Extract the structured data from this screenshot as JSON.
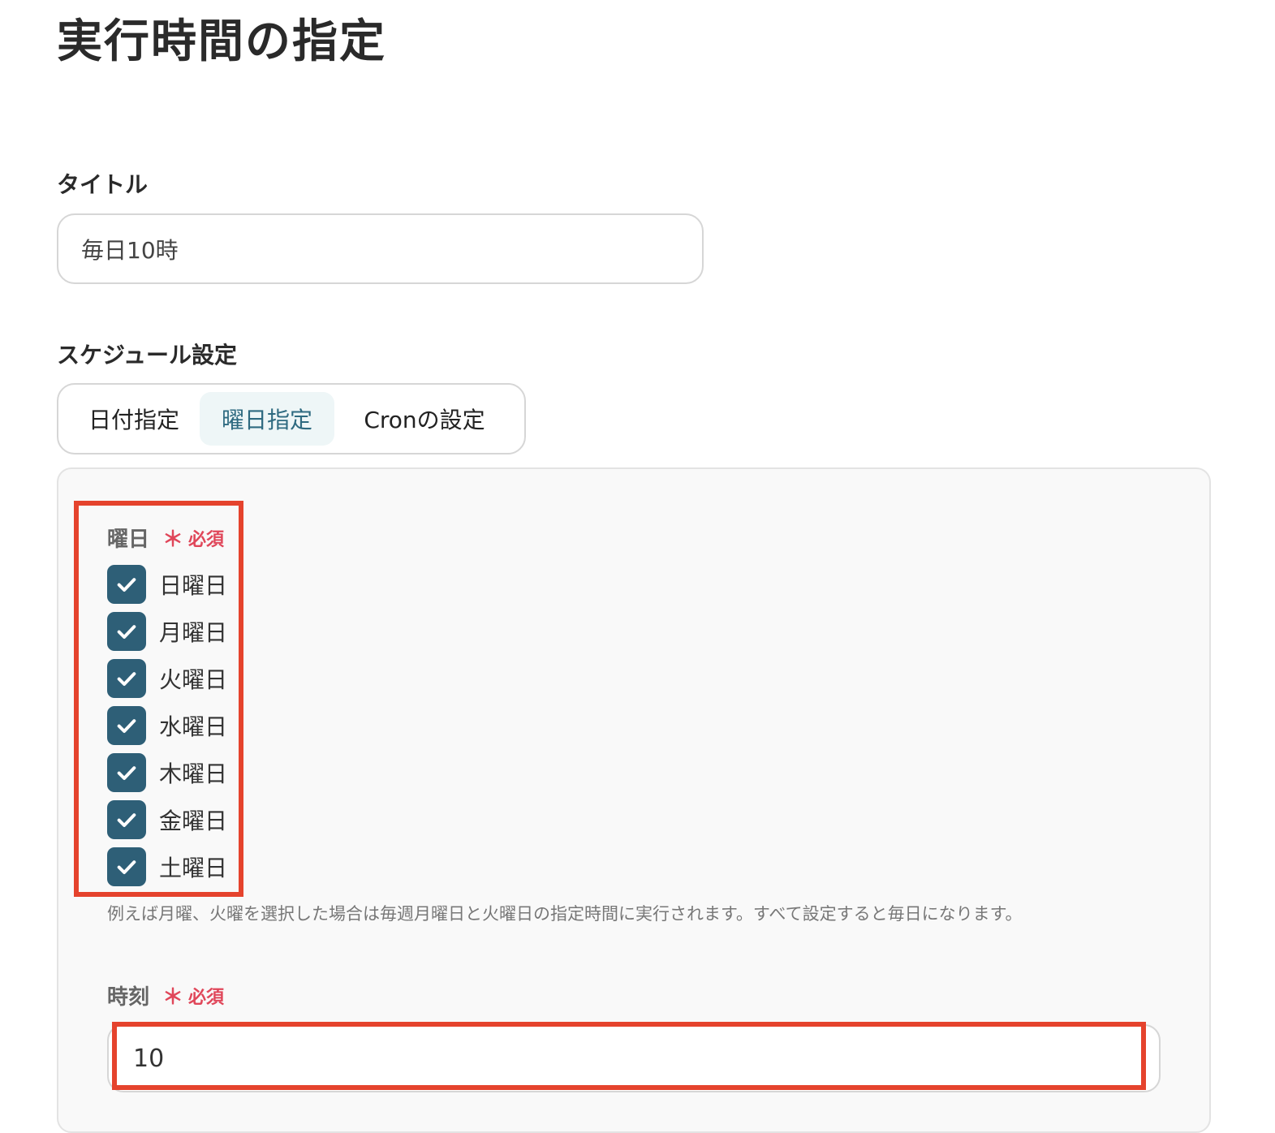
{
  "page": {
    "title": "実行時間の指定"
  },
  "title_field": {
    "label": "タイトル",
    "value": "毎日10時"
  },
  "schedule": {
    "label": "スケジュール設定",
    "tabs": [
      {
        "label": "日付指定",
        "selected": false
      },
      {
        "label": "曜日指定",
        "selected": true
      },
      {
        "label": "Cronの設定",
        "selected": false
      }
    ]
  },
  "weekday": {
    "label": "曜日",
    "required_mark": "＊",
    "required_text": "必須",
    "days": [
      {
        "label": "日曜日",
        "checked": true
      },
      {
        "label": "月曜日",
        "checked": true
      },
      {
        "label": "火曜日",
        "checked": true
      },
      {
        "label": "水曜日",
        "checked": true
      },
      {
        "label": "木曜日",
        "checked": true
      },
      {
        "label": "金曜日",
        "checked": true
      },
      {
        "label": "土曜日",
        "checked": true
      }
    ],
    "hint": "例えば月曜、火曜を選択した場合は毎週月曜日と火曜日の指定時間に実行されます。すべて設定すると毎日になります。"
  },
  "time": {
    "label": "時刻",
    "required_mark": "＊",
    "required_text": "必須",
    "value": "10"
  },
  "colors": {
    "checkbox": "#2e5f77",
    "selected_tab_bg": "#eef6f7",
    "selected_tab_text": "#2e6a80",
    "required": "#e0475a",
    "highlight": "#e5432d"
  },
  "icons": {
    "checkbox_check": "check-icon"
  }
}
